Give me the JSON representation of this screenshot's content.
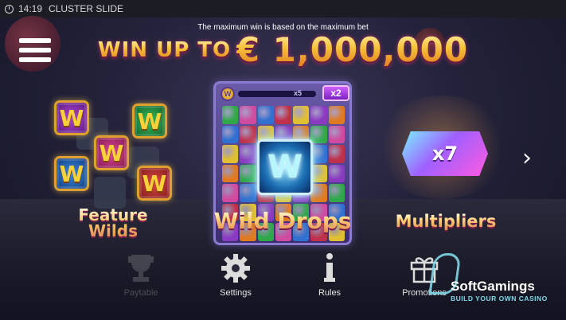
{
  "titlebar": {
    "time": "14:19",
    "title": "CLUSTER SLIDE"
  },
  "header": {
    "note": "The maximum win is based on the maximum bet",
    "win_prefix": "WIN UP TO",
    "win_amount": "€ 1,000,000"
  },
  "features": {
    "wilds": {
      "line1": "Feature",
      "line2": "Wilds",
      "tile_symbol": "W"
    },
    "wild_drops": {
      "label": "Wild Drops",
      "meter_coin": "W",
      "meter_level": "x5",
      "meter_multiplier": "x2",
      "wild_symbol": "W"
    },
    "multipliers": {
      "label": "Multipliers",
      "value": "x7"
    }
  },
  "nav": {
    "paytable": "Paytable",
    "settings": "Settings",
    "rules": "Rules",
    "promotions": "Promotions"
  },
  "watermark": {
    "name": "SoftGamings",
    "tagline": "BUILD YOUR OWN CASINO"
  },
  "colors": {
    "gem_palette": [
      "#2fa84a",
      "#c0304a",
      "#e07a20",
      "#3070d0",
      "#8a3ac0",
      "#d04aa0",
      "#e0c030"
    ]
  }
}
